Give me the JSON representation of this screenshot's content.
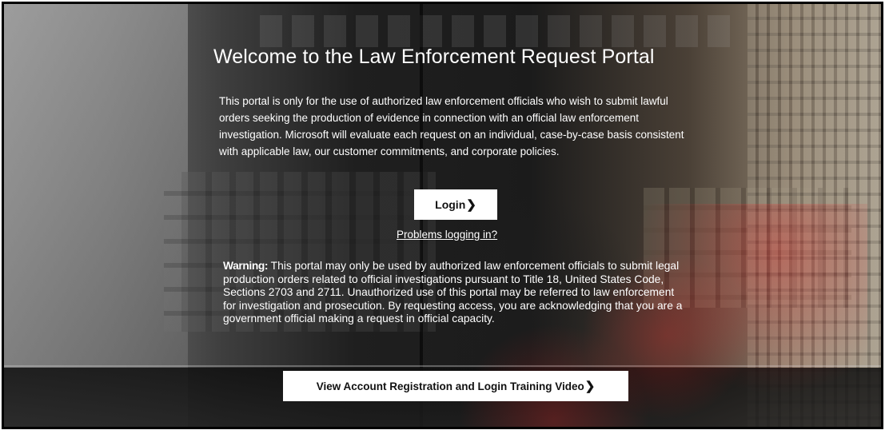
{
  "portal": {
    "title": "Welcome to the Law Enforcement Request Portal",
    "intro": "This portal is only for the use of authorized law enforcement officials who wish to submit lawful orders seeking the production of evidence in connection with an official law enforcement investigation. Microsoft will evaluate each request on an individual, case-by-case basis consistent with applicable law, our customer commitments, and corporate policies.",
    "login_label": "Login",
    "problems_link": "Problems logging in?",
    "warning_label": "Warning:",
    "warning_text": " This portal may only be used by authorized law enforcement officials to submit legal production orders related to official investigations pursuant to Title 18, United States Code, Sections 2703 and 2711. Unauthorized use of this portal may be referred to law enforcement for investigation and prosecution. By requesting access, you are acknowledging that you are a government official making a request in official capacity.",
    "video_label": "View Account Registration and Login Training Video"
  },
  "icons": {
    "login_chevron": "chevron-right-icon",
    "video_chevron": "chevron-right-icon"
  },
  "colors": {
    "text": "#ffffff",
    "button_bg": "#ffffff",
    "button_text": "#111111",
    "border": "#000000"
  }
}
